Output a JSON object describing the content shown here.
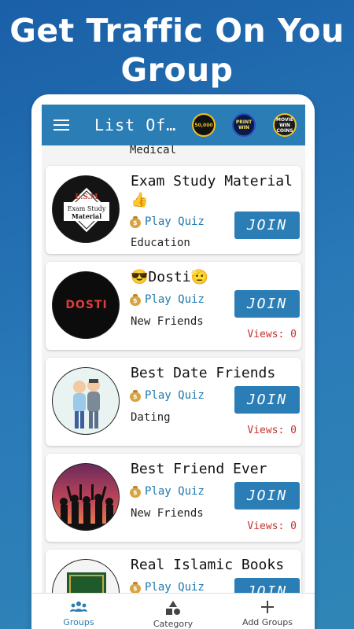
{
  "promo": {
    "line1": "Get Traffic On You",
    "line2": "Group"
  },
  "appbar": {
    "title": "List Of…",
    "badges": [
      {
        "text1": "50,000",
        "text2": ""
      },
      {
        "text1": "PRINT",
        "text2": "WIN"
      },
      {
        "text1": "MOVIE",
        "text2": "WIN COINS"
      }
    ]
  },
  "list": {
    "clipped_text": "Medical",
    "items": [
      {
        "name": "Exam Study Material 👍",
        "quiz": "Play Quiz",
        "category": "Education",
        "join": "JOIN",
        "views": "",
        "avatar": "esm"
      },
      {
        "name": "😎Dosti🫡",
        "quiz": "Play Quiz",
        "category": "New Friends",
        "join": "JOIN",
        "views": "Views: 0",
        "avatar": "dosti"
      },
      {
        "name": "Best Date Friends",
        "quiz": "Play Quiz",
        "category": "Dating",
        "join": "JOIN",
        "views": "Views: 0",
        "avatar": "date"
      },
      {
        "name": "Best Friend Ever",
        "quiz": "Play Quiz",
        "category": "New Friends",
        "join": "JOIN",
        "views": "Views: 0",
        "avatar": "friends"
      },
      {
        "name": "Real Islamic Books",
        "quiz": "Play Quiz",
        "category": "",
        "join": "JOIN",
        "views": "",
        "avatar": "books"
      }
    ],
    "avatar_texts": {
      "esm_top": "E.S.M",
      "esm_bottom1": "Exam Study",
      "esm_bottom2": "Material",
      "dosti": "DOSTI"
    }
  },
  "navbar": {
    "items": [
      {
        "label": "Groups",
        "icon": "groups-icon",
        "active": true
      },
      {
        "label": "Category",
        "icon": "category-icon",
        "active": false
      },
      {
        "label": "Add Groups",
        "icon": "plus-icon",
        "active": false
      }
    ]
  },
  "colors": {
    "primary": "#2b7db5",
    "views": "#c83030",
    "quiz": "#1e78b0"
  }
}
